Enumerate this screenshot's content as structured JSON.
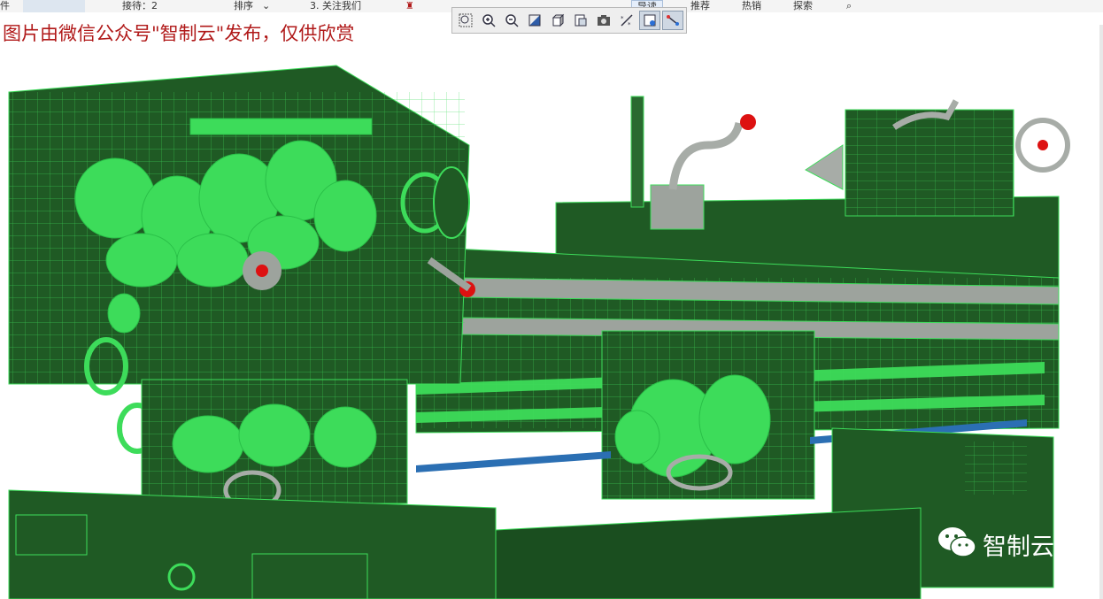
{
  "top_bar": {
    "item1": "件",
    "item2": "接待：2",
    "item3": "排序",
    "item4": "3. 关注我们",
    "item5": "导读",
    "item6": "推荐",
    "item7": "热销",
    "item8": "探索"
  },
  "watermark": "图片由微信公众号\"智制云\"发布，仅供欣赏",
  "toolbar": {
    "icons": [
      "zoom-window-icon",
      "zoom-in-icon",
      "zoom-out-icon",
      "shaded-display-icon",
      "view-cube-icon",
      "saved-views-icon",
      "screenshot-icon",
      "datum-toggle-icon",
      "spin-center-icon",
      "annotation-display-icon"
    ]
  },
  "brand": {
    "text": "智制云",
    "icon": "wechat-icon"
  },
  "colors": {
    "body_green": "#1f5a24",
    "wire_green": "#3ddc5a",
    "grey_metal": "#9da39d",
    "red_knob": "#dd1111",
    "blue_rail": "#2b6fb3"
  }
}
